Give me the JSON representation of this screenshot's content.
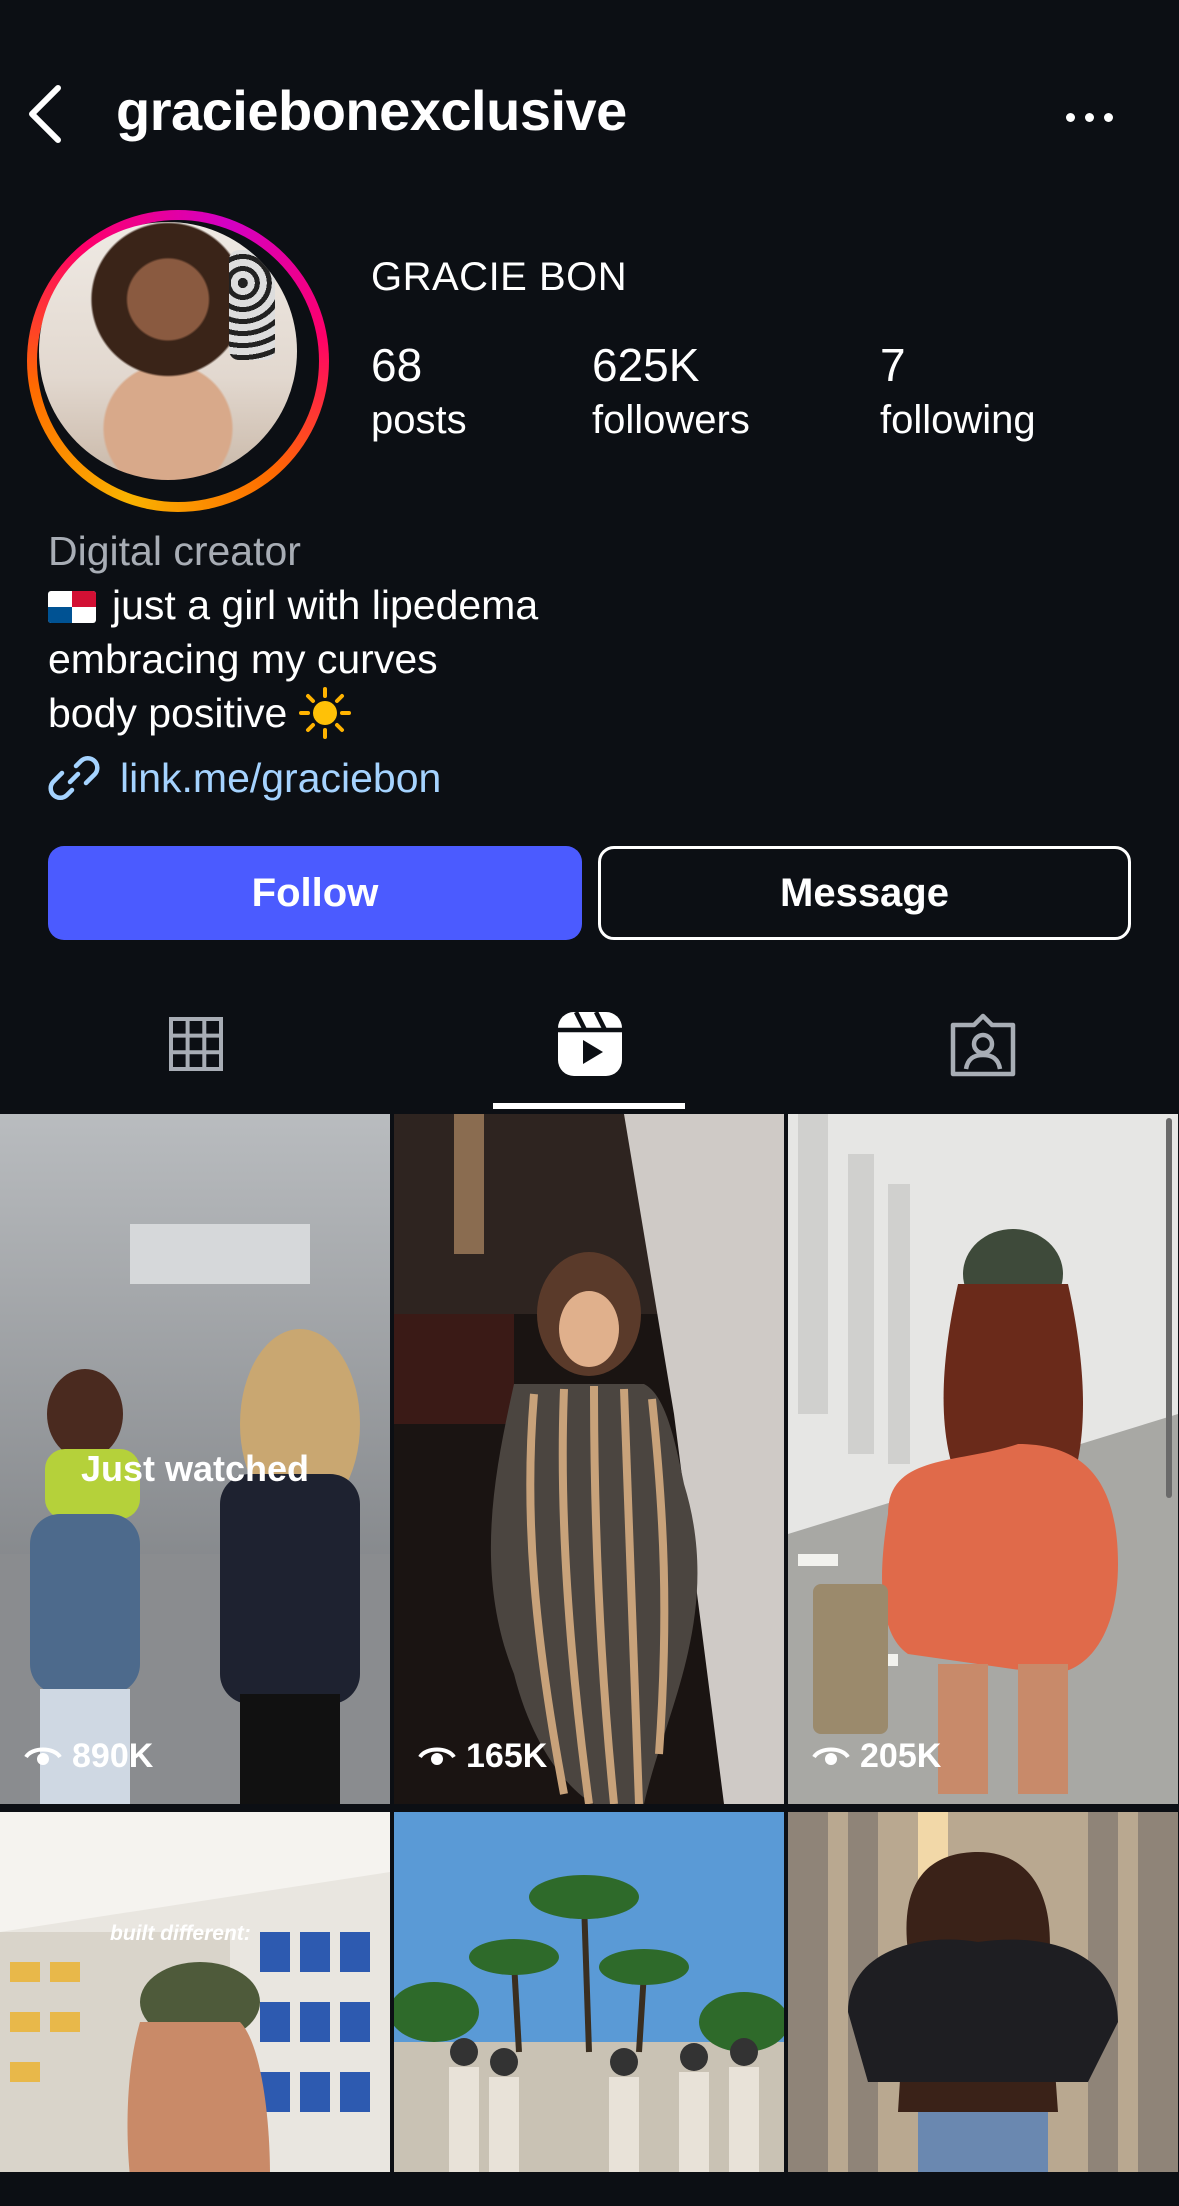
{
  "header": {
    "username": "graciebonexclusive",
    "back_icon": "chevron-left-icon",
    "more_icon": "more-horizontal-icon"
  },
  "profile": {
    "display_name": "GRACIE BON",
    "stats": [
      {
        "value": "68",
        "label": "posts"
      },
      {
        "value": "625K",
        "label": "followers"
      },
      {
        "value": "7",
        "label": "following"
      }
    ],
    "category": "Digital creator",
    "bio_lines": [
      "just a girl with lipedema",
      "embracing my curves",
      "body positive"
    ],
    "flag_icon": "panama-flag-icon",
    "sun_icon": "sun-emoji-icon",
    "link": "link.me/graciebon"
  },
  "actions": {
    "follow_label": "Follow",
    "message_label": "Message",
    "follow_color": "#4b5bff"
  },
  "tabs": [
    {
      "name": "posts",
      "icon": "grid-icon",
      "active": false
    },
    {
      "name": "reels",
      "icon": "reels-icon",
      "active": true
    },
    {
      "name": "tagged",
      "icon": "tagged-icon",
      "active": false
    }
  ],
  "reels": [
    {
      "views": "890K",
      "badge": "Just watched"
    },
    {
      "views": "165K"
    },
    {
      "views": "205K"
    },
    {
      "caption": "built different:"
    },
    {},
    {}
  ]
}
